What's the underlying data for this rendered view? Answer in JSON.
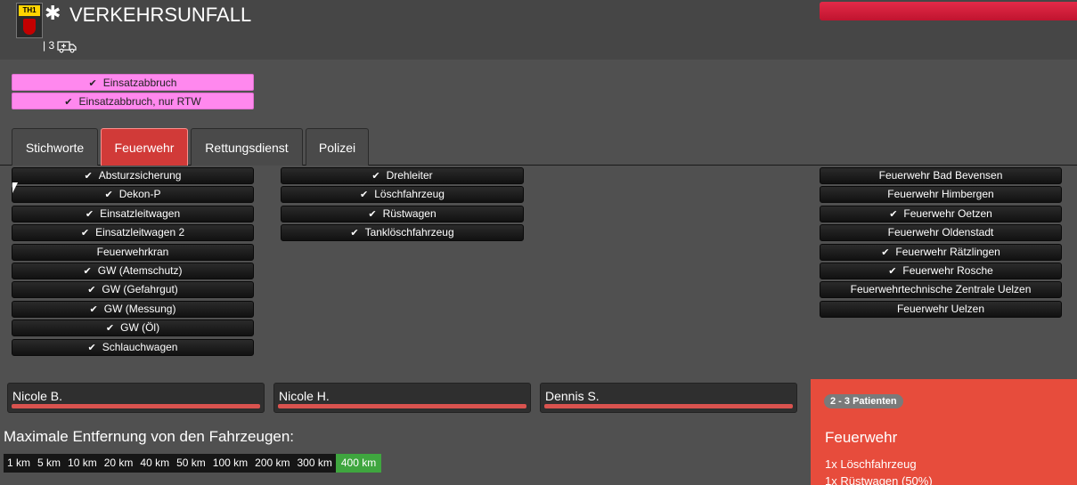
{
  "header": {
    "badge_text": "TH1",
    "title_icon": "✱",
    "title": "VERKEHRSUNFALL",
    "patients_prefix": "| 3",
    "ambulance_icon": "ambulance-icon",
    "progress_color": "#d41f3a"
  },
  "abort_buttons": [
    {
      "label": "Einsatzabbruch"
    },
    {
      "label": "Einsatzabbruch, nur RTW"
    }
  ],
  "tabs": [
    {
      "label": "Stichworte",
      "active": false
    },
    {
      "label": "Feuerwehr",
      "active": true
    },
    {
      "label": "Rettungsdienst",
      "active": false
    },
    {
      "label": "Polizei",
      "active": false
    }
  ],
  "vehicle_types_col1": [
    {
      "label": "Absturzsicherung",
      "checked": true
    },
    {
      "label": "Dekon-P",
      "checked": true
    },
    {
      "label": "Einsatzleitwagen",
      "checked": true
    },
    {
      "label": "Einsatzleitwagen 2",
      "checked": true
    },
    {
      "label": "Feuerwehrkran",
      "checked": false
    },
    {
      "label": "GW (Atemschutz)",
      "checked": true
    },
    {
      "label": "GW (Gefahrgut)",
      "checked": true
    },
    {
      "label": "GW (Messung)",
      "checked": true
    },
    {
      "label": "GW (Öl)",
      "checked": true
    },
    {
      "label": "Schlauchwagen",
      "checked": true
    }
  ],
  "vehicle_types_col2": [
    {
      "label": "Drehleiter",
      "checked": true
    },
    {
      "label": "Löschfahrzeug",
      "checked": true
    },
    {
      "label": "Rüstwagen",
      "checked": true
    },
    {
      "label": "Tanklöschfahrzeug",
      "checked": true
    }
  ],
  "stations": [
    {
      "label": "Feuerwehr Bad Bevensen",
      "checked": false
    },
    {
      "label": "Feuerwehr Himbergen",
      "checked": false
    },
    {
      "label": "Feuerwehr Oetzen",
      "checked": true
    },
    {
      "label": "Feuerwehr Oldenstadt",
      "checked": false
    },
    {
      "label": "Feuerwehr Rätzlingen",
      "checked": true
    },
    {
      "label": "Feuerwehr Rosche",
      "checked": true
    },
    {
      "label": "Feuerwehrtechnische Zentrale Uelzen",
      "checked": false
    },
    {
      "label": "Feuerwehr Uelzen",
      "checked": false
    }
  ],
  "personnel": [
    {
      "name": "Nicole B."
    },
    {
      "name": "Nicole H."
    },
    {
      "name": "Dennis S."
    }
  ],
  "distance": {
    "label": "Maximale Entfernung von den Fahrzeugen:",
    "options": [
      "1 km",
      "5 km",
      "10 km",
      "20 km",
      "40 km",
      "50 km",
      "100 km",
      "200 km",
      "300 km",
      "400 km"
    ],
    "selected": "400 km"
  },
  "requirements": {
    "badge": "2 - 3 Patienten",
    "heading": "Feuerwehr",
    "lines": [
      "1x Löschfahrzeug",
      "1x Rüstwagen (50%)"
    ],
    "color": "#e74c3c"
  }
}
